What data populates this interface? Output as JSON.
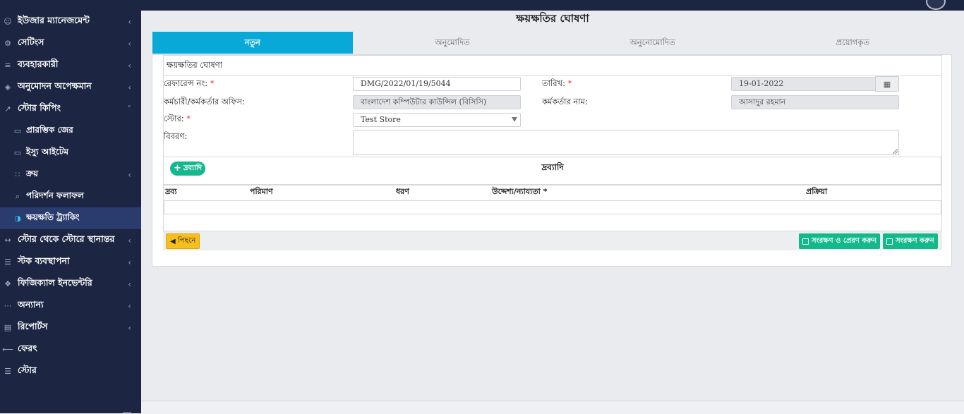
{
  "sidebar": {
    "items": [
      {
        "label": "ইউজার ম্যানেজমেন্ট",
        "icon": "user-icon",
        "glyph": "☺",
        "chevron": "‹"
      },
      {
        "label": "সেটিংস",
        "icon": "gear-icon",
        "glyph": "⚙",
        "chevron": "‹"
      },
      {
        "label": "ব্যবহারকারী",
        "icon": "cart-icon",
        "glyph": "≡",
        "chevron": "‹"
      },
      {
        "label": "অনুমোদন অপেক্ষমান",
        "icon": "cube-icon",
        "glyph": "◈",
        "chevron": "‹"
      },
      {
        "label": "স্টোর কিপিং",
        "icon": "chart-icon",
        "glyph": "↗",
        "chevron": "˅"
      },
      {
        "label": "প্রারম্ভিক জের",
        "icon": "folder-icon",
        "glyph": "▭"
      },
      {
        "label": "ইস্যু আইটেম",
        "icon": "folder-icon",
        "glyph": "▭"
      },
      {
        "label": "ক্রয়",
        "icon": "sitemap-icon",
        "glyph": "∷",
        "chevron": "‹"
      },
      {
        "label": "পরিদর্শন ফলাফল",
        "icon": "search-icon",
        "glyph": "⌕"
      },
      {
        "label": "ক্ষয়ক্ষতি ট্র্যাকিং",
        "icon": "half-circle-icon",
        "glyph": "◑"
      },
      {
        "label": "স্টোর থেকে স্টোরে স্থানান্তর",
        "icon": "arrows-icon",
        "glyph": "↔",
        "chevron": "‹"
      },
      {
        "label": "স্টক ব্যবস্থাপনা",
        "icon": "sliders-icon",
        "glyph": "☰",
        "chevron": "‹"
      },
      {
        "label": "ফিজিক্যাল ইনভেন্টরি",
        "icon": "cubes-icon",
        "glyph": "❖",
        "chevron": "‹"
      },
      {
        "label": "অন্যান্য",
        "icon": "dots-icon",
        "glyph": "⋯",
        "chevron": "‹"
      },
      {
        "label": "রিপোর্টস",
        "icon": "report-icon",
        "glyph": "▤",
        "chevron": "‹"
      },
      {
        "label": "ফেরৎ",
        "icon": "arrow-left-icon",
        "glyph": "⟵"
      },
      {
        "label": "স্টোর",
        "icon": "sliders-icon",
        "glyph": "☰"
      }
    ]
  },
  "page": {
    "title": "ক্ষয়ক্ষতির ঘোষণা"
  },
  "tabs": [
    "নতুন",
    "অনুমোদিত",
    "অনুনোমোদিত",
    "প্রয়োগকৃত"
  ],
  "form": {
    "header": "ক্ষয়ক্ষতির ঘোষণা",
    "reference_label": "রেফারেন্স নং:",
    "reference_value": "DMG/2022/01/19/5044",
    "date_label": "তারিখ:",
    "date_value": "19-01-2022",
    "office_label": "কর্মচারী/কর্মকর্তার অফিস:",
    "office_value": "বাংলাদেশ কম্পিউটার কাউন্সিল (বিসিসি)",
    "officer_label": "কর্মকর্তার নাম:",
    "officer_value": "আসাদুর রহমান",
    "store_label": "স্টোর:",
    "store_value": "Test Store",
    "description_label": "বিবরণ:",
    "required_mark": "*"
  },
  "items": {
    "add_label": "দ্রব্যাদি",
    "title": "দ্রব্যাদি",
    "columns": [
      "দ্রব্য",
      "পরিমাণ",
      "ধরণ",
      "উদ্দেশ্য/ন্যায্যতা *",
      "প্রক্রিয়া"
    ]
  },
  "actions": {
    "back": "পিছনে",
    "save_send": "সংরক্ষণ ও প্রেরণ করুন",
    "save": "সংরক্ষণ করুন"
  },
  "colors": {
    "sidebar": "#1c2541",
    "tab_active": "#08a9d7",
    "save": "#12ba8b",
    "back": "#f8be1a",
    "required": "#e0352b"
  }
}
